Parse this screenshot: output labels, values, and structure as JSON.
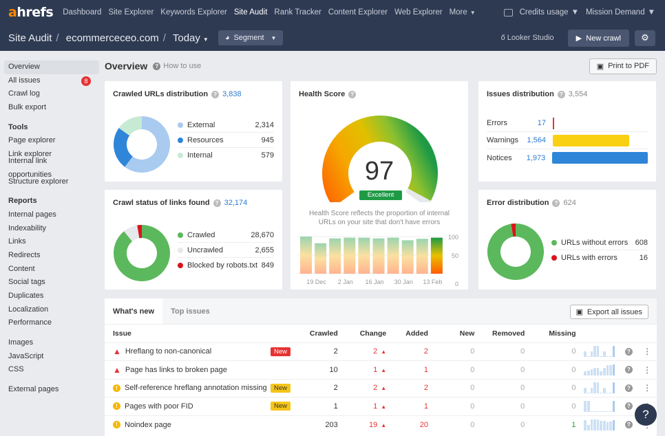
{
  "nav": {
    "logo_a": "a",
    "logo_rest": "hrefs",
    "items": [
      "Dashboard",
      "Site Explorer",
      "Keywords Explorer",
      "Site Audit",
      "Rank Tracker",
      "Content Explorer",
      "Web Explorer",
      "More"
    ],
    "active": "Site Audit",
    "credits": "Credits usage",
    "account": "Mission Demand"
  },
  "sub": {
    "crumbs": [
      "Site Audit",
      "ecommerceceo.com",
      "Today"
    ],
    "segment": "Segment",
    "looker": "Looker Studio",
    "new_crawl": "New crawl"
  },
  "sidebar": {
    "top": [
      {
        "label": "Overview",
        "active": true
      },
      {
        "label": "All issues",
        "badge": "8"
      },
      {
        "label": "Crawl log"
      },
      {
        "label": "Bulk export"
      }
    ],
    "tools_head": "Tools",
    "tools": [
      "Page explorer",
      "Link explorer",
      "Internal link opportunities",
      "Structure explorer"
    ],
    "reports_head": "Reports",
    "reports": [
      "Internal pages",
      "Indexability",
      "Links",
      "Redirects",
      "Content",
      "Social tags",
      "Duplicates",
      "Localization",
      "Performance"
    ],
    "resources": [
      "Images",
      "JavaScript",
      "CSS"
    ],
    "external": [
      "External pages"
    ]
  },
  "overview": {
    "title": "Overview",
    "how_to": "How to use",
    "print": "Print to PDF"
  },
  "crawled_urls": {
    "title": "Crawled URLs distribution",
    "total": "3,838",
    "items": [
      {
        "label": "External",
        "value": "2,314",
        "n": 2314,
        "color": "#a9cbef"
      },
      {
        "label": "Resources",
        "value": "945",
        "n": 945,
        "color": "#2f86d8"
      },
      {
        "label": "Internal",
        "value": "579",
        "n": 579,
        "color": "#c7ead4"
      }
    ]
  },
  "crawl_status": {
    "title": "Crawl status of links found",
    "total": "32,174",
    "items": [
      {
        "label": "Crawled",
        "value": "28,670",
        "n": 28670,
        "color": "#5cb85c"
      },
      {
        "label": "Uncrawled",
        "value": "2,655",
        "n": 2655,
        "color": "#e6e8eb"
      },
      {
        "label": "Blocked by robots.txt",
        "value": "849",
        "n": 849,
        "color": "#d9141b"
      }
    ]
  },
  "health": {
    "title": "Health Score",
    "score": "97",
    "score_value": 97,
    "rating": "Excellent",
    "desc1": "Health Score reflects the proportion of internal",
    "desc2": "URLs on your site that don't have errors",
    "history": [
      100,
      82,
      95,
      97,
      97,
      95,
      97,
      90,
      94,
      97
    ],
    "x_labels": [
      "19 Dec",
      "2 Jan",
      "16 Jan",
      "30 Jan",
      "13 Feb"
    ],
    "y_labels": [
      "100",
      "50",
      "0"
    ]
  },
  "issues_dist": {
    "title": "Issues distribution",
    "total": "3,554",
    "items": [
      {
        "label": "Errors",
        "value": "17",
        "n": 17,
        "color": "#e63232"
      },
      {
        "label": "Warnings",
        "value": "1,564",
        "n": 1564,
        "color": "#fad013"
      },
      {
        "label": "Notices",
        "value": "1,973",
        "n": 1973,
        "color": "#2f86d8"
      }
    ]
  },
  "error_dist": {
    "title": "Error distribution",
    "total": "624",
    "items": [
      {
        "label": "URLs without errors",
        "value": "608",
        "n": 608,
        "color": "#5cb85c"
      },
      {
        "label": "URLs with errors",
        "value": "16",
        "n": 16,
        "color": "#d9141b"
      }
    ]
  },
  "table": {
    "tabs": [
      "What's new",
      "Top issues"
    ],
    "export": "Export all issues",
    "columns": [
      "Issue",
      "Crawled",
      "Change",
      "Added",
      "New",
      "Removed",
      "Missing"
    ],
    "rows": [
      {
        "type": "error",
        "issue": "Hreflang to non-canonical",
        "tag": "New",
        "tag_color": "red",
        "crawled": "2",
        "change": "2",
        "added": "2",
        "new": "0",
        "removed": "0",
        "missing": "0",
        "spark": [
          0.5,
          0.1,
          0.5,
          1,
          1,
          0.1,
          0.5,
          0.1,
          0.1,
          1
        ]
      },
      {
        "type": "error",
        "issue": "Page has links to broken page",
        "tag": "",
        "crawled": "10",
        "change": "1",
        "added": "1",
        "new": "0",
        "removed": "0",
        "missing": "0",
        "spark": [
          0.35,
          0.45,
          0.55,
          0.65,
          0.7,
          0.35,
          0.7,
          0.9,
          0.9,
          1
        ]
      },
      {
        "type": "warning",
        "issue": "Self-reference hreflang annotation missing",
        "tag": "New",
        "tag_color": "yellow",
        "crawled": "2",
        "change": "2",
        "added": "2",
        "new": "0",
        "removed": "0",
        "missing": "0",
        "spark": [
          0.5,
          0.1,
          0.5,
          1,
          1,
          0.1,
          0.5,
          0.1,
          0.1,
          1
        ]
      },
      {
        "type": "warning",
        "issue": "Pages with poor FID",
        "tag": "New",
        "tag_color": "yellow",
        "crawled": "1",
        "change": "1",
        "added": "1",
        "new": "0",
        "removed": "0",
        "missing": "0",
        "spark": [
          1,
          1,
          0.05,
          0.05,
          0.05,
          0.05,
          0.05,
          0.05,
          0.05,
          1
        ]
      },
      {
        "type": "warning",
        "issue": "Noindex page",
        "tag": "",
        "crawled": "203",
        "change": "19",
        "added": "20",
        "new": "0",
        "removed": "0",
        "missing": "1",
        "spark": [
          0.9,
          0.5,
          0.95,
          0.95,
          0.95,
          0.85,
          0.85,
          0.7,
          0.8,
          0.9
        ]
      }
    ]
  },
  "help": "?"
}
